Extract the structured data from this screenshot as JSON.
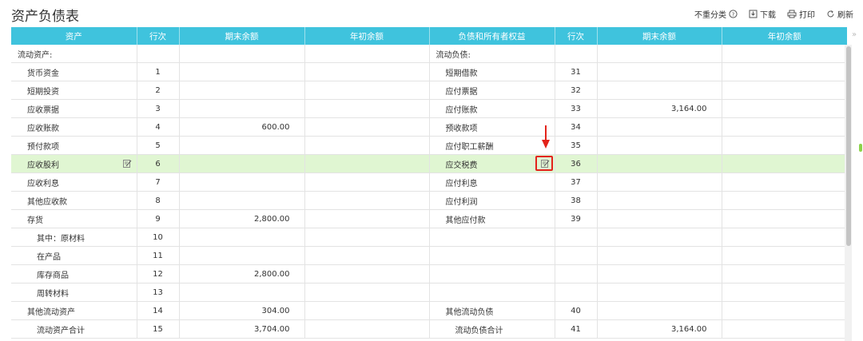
{
  "page": {
    "title": "资产负债表"
  },
  "toolbar": {
    "unclassified": "不重分类",
    "download": "下载",
    "print": "打印",
    "refresh": "刷新"
  },
  "columns": [
    "资产",
    "行次",
    "期末余额",
    "年初余额",
    "负债和所有者权益",
    "行次",
    "期末余额",
    "年初余额"
  ],
  "rows": [
    {
      "a_label": "流动资产:",
      "a_indent": 0,
      "a_line": "",
      "a_end": "",
      "a_begin": "",
      "l_label": "流动负债:",
      "l_indent": 0,
      "l_line": "",
      "l_end": "",
      "l_begin": ""
    },
    {
      "a_label": "货币资金",
      "a_indent": 1,
      "a_line": "1",
      "a_end": "",
      "a_begin": "",
      "l_label": "短期借款",
      "l_indent": 1,
      "l_line": "31",
      "l_end": "",
      "l_begin": ""
    },
    {
      "a_label": "短期投资",
      "a_indent": 1,
      "a_line": "2",
      "a_end": "",
      "a_begin": "",
      "l_label": "应付票据",
      "l_indent": 1,
      "l_line": "32",
      "l_end": "",
      "l_begin": ""
    },
    {
      "a_label": "应收票据",
      "a_indent": 1,
      "a_line": "3",
      "a_end": "",
      "a_begin": "",
      "l_label": "应付账款",
      "l_indent": 1,
      "l_line": "33",
      "l_end": "3,164.00",
      "l_begin": ""
    },
    {
      "a_label": "应收账款",
      "a_indent": 1,
      "a_line": "4",
      "a_end": "600.00",
      "a_begin": "",
      "l_label": "预收款项",
      "l_indent": 1,
      "l_line": "34",
      "l_end": "",
      "l_begin": ""
    },
    {
      "a_label": "预付款项",
      "a_indent": 1,
      "a_line": "5",
      "a_end": "",
      "a_begin": "",
      "l_label": "应付职工薪酬",
      "l_indent": 1,
      "l_line": "35",
      "l_end": "",
      "l_begin": ""
    },
    {
      "a_label": "应收股利",
      "a_indent": 1,
      "a_line": "6",
      "a_end": "",
      "a_begin": "",
      "l_label": "应交税费",
      "l_indent": 1,
      "l_line": "36",
      "l_end": "",
      "l_begin": "",
      "highlight": true
    },
    {
      "a_label": "应收利息",
      "a_indent": 1,
      "a_line": "7",
      "a_end": "",
      "a_begin": "",
      "l_label": "应付利息",
      "l_indent": 1,
      "l_line": "37",
      "l_end": "",
      "l_begin": ""
    },
    {
      "a_label": "其他应收款",
      "a_indent": 1,
      "a_line": "8",
      "a_end": "",
      "a_begin": "",
      "l_label": "应付利润",
      "l_indent": 1,
      "l_line": "38",
      "l_end": "",
      "l_begin": ""
    },
    {
      "a_label": "存货",
      "a_indent": 1,
      "a_line": "9",
      "a_end": "2,800.00",
      "a_begin": "",
      "l_label": "其他应付款",
      "l_indent": 1,
      "l_line": "39",
      "l_end": "",
      "l_begin": ""
    },
    {
      "a_label": "其中：原材料",
      "a_indent": 2,
      "a_line": "10",
      "a_end": "",
      "a_begin": "",
      "l_label": "",
      "l_indent": 0,
      "l_line": "",
      "l_end": "",
      "l_begin": ""
    },
    {
      "a_label": "在产品",
      "a_indent": 2,
      "a_line": "11",
      "a_end": "",
      "a_begin": "",
      "l_label": "",
      "l_indent": 0,
      "l_line": "",
      "l_end": "",
      "l_begin": ""
    },
    {
      "a_label": "库存商品",
      "a_indent": 2,
      "a_line": "12",
      "a_end": "2,800.00",
      "a_begin": "",
      "l_label": "",
      "l_indent": 0,
      "l_line": "",
      "l_end": "",
      "l_begin": ""
    },
    {
      "a_label": "周转材料",
      "a_indent": 2,
      "a_line": "13",
      "a_end": "",
      "a_begin": "",
      "l_label": "",
      "l_indent": 0,
      "l_line": "",
      "l_end": "",
      "l_begin": ""
    },
    {
      "a_label": "其他流动资产",
      "a_indent": 1,
      "a_line": "14",
      "a_end": "304.00",
      "a_begin": "",
      "l_label": "其他流动负债",
      "l_indent": 1,
      "l_line": "40",
      "l_end": "",
      "l_begin": ""
    },
    {
      "a_label": "流动资产合计",
      "a_indent": 2,
      "a_line": "15",
      "a_end": "3,704.00",
      "a_begin": "",
      "l_label": "流动负债合计",
      "l_indent": 2,
      "l_line": "41",
      "l_end": "3,164.00",
      "l_begin": ""
    }
  ],
  "colors": {
    "header_bg": "#3fc3dd",
    "highlight_row": "#e0f6d2",
    "annotation_red": "#e3231a"
  },
  "icons": [
    "help-icon",
    "download-icon",
    "print-icon",
    "refresh-icon",
    "edit-icon",
    "arrow-down-icon"
  ]
}
